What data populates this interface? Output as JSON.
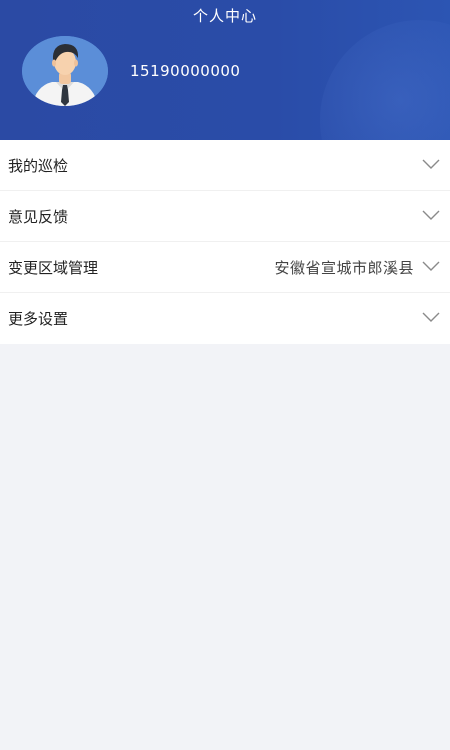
{
  "header": {
    "title": "个人中心",
    "phone": "15190000000"
  },
  "menu": {
    "items": [
      {
        "label": "我的巡检",
        "value": ""
      },
      {
        "label": "意见反馈",
        "value": ""
      },
      {
        "label": "变更区域管理",
        "value": "安徽省宣城市郎溪县"
      },
      {
        "label": "更多设置",
        "value": ""
      }
    ]
  },
  "colors": {
    "header_bg": "#2b4aa4",
    "page_bg": "#f2f3f7",
    "avatar_bg": "#5b8ed8"
  },
  "icons": {
    "avatar": "user-avatar-icon",
    "chevron": "chevron-down-icon"
  }
}
